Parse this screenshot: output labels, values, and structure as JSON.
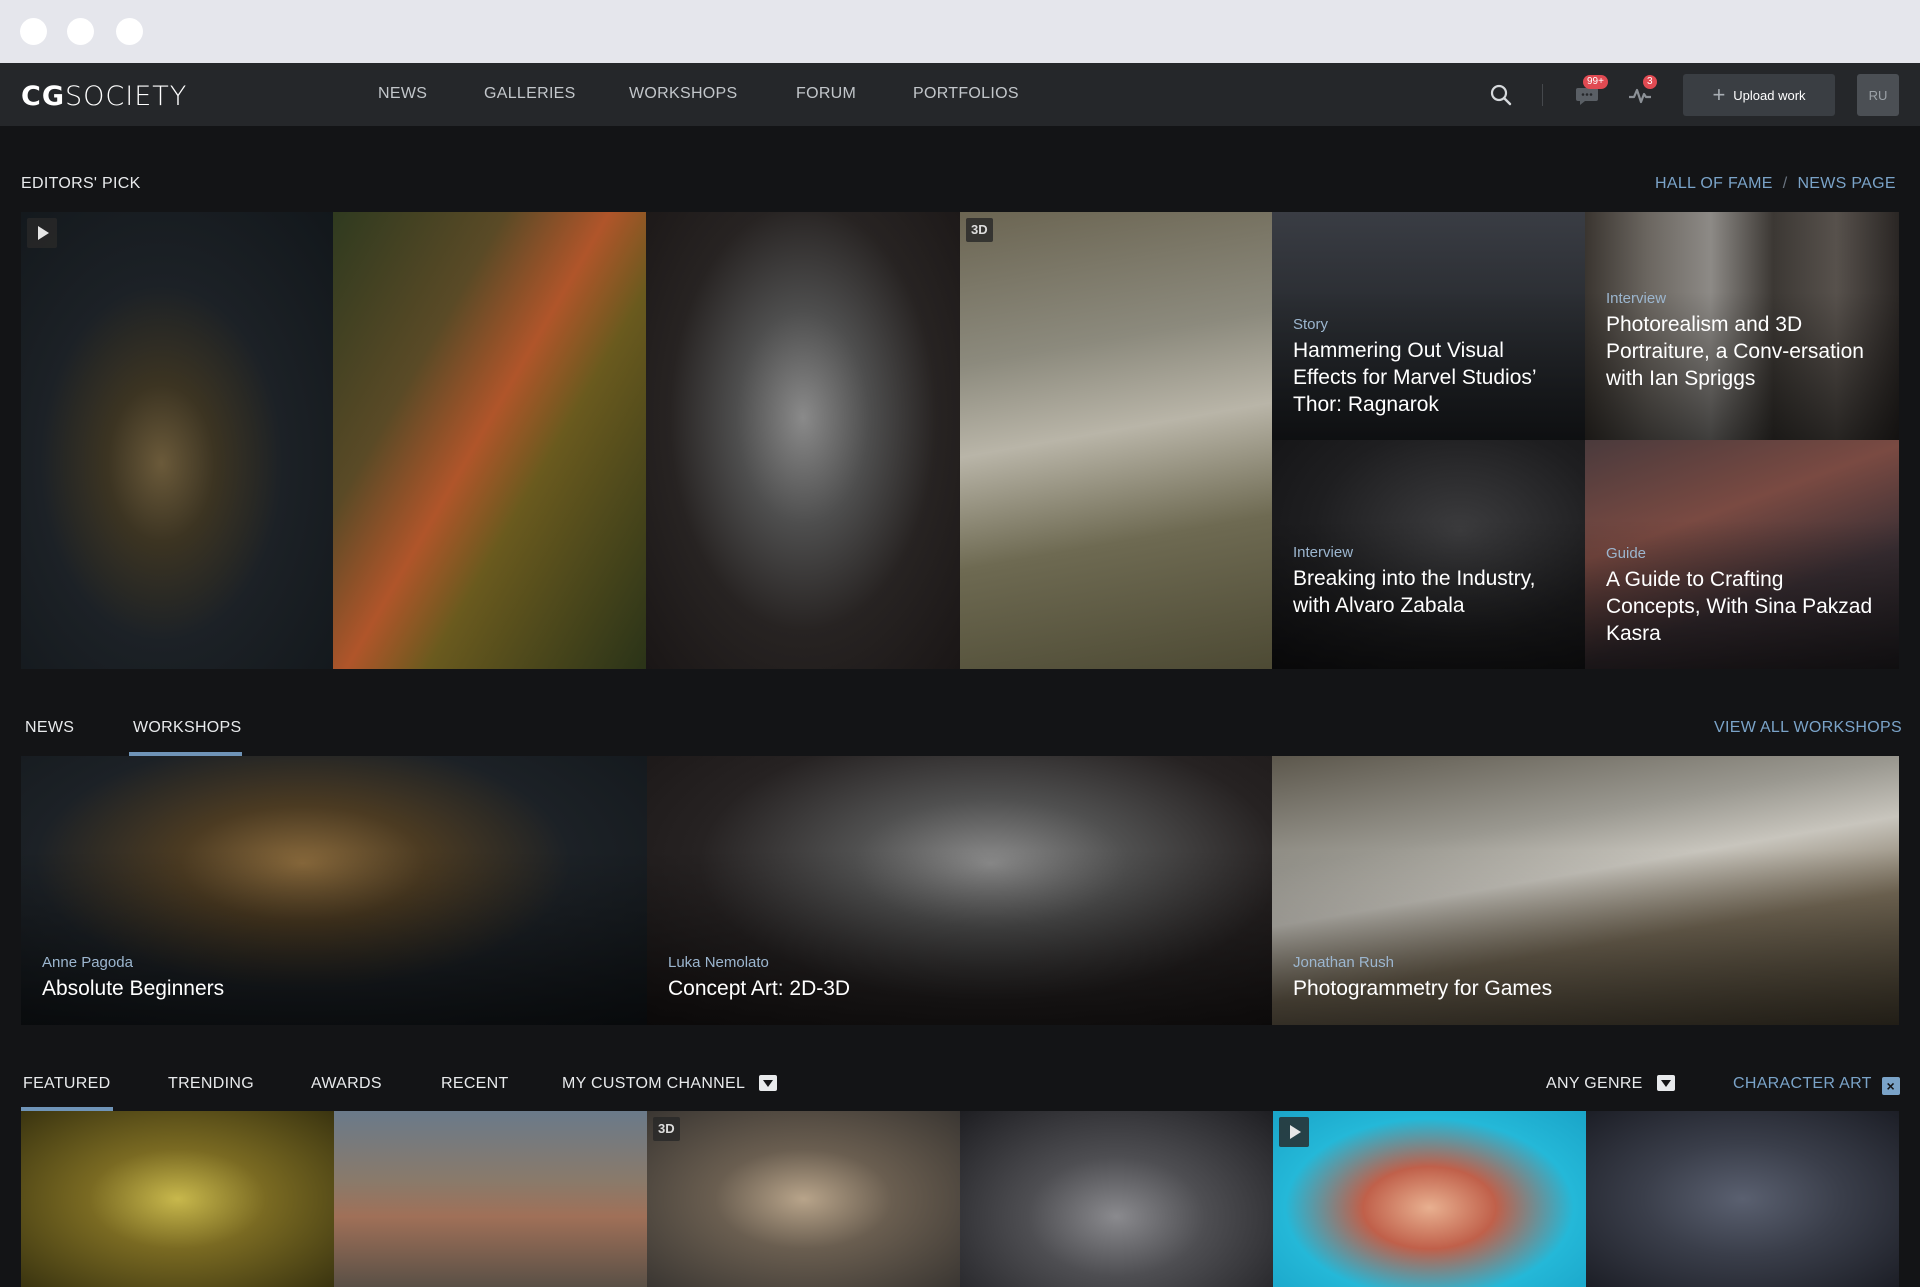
{
  "brand": {
    "logo_bold": "CG",
    "logo_light": "SOCIETY"
  },
  "nav": {
    "items": [
      "NEWS",
      "GALLERIES",
      "WORKSHOPS",
      "FORUM",
      "PORTFOLIOS"
    ],
    "messages_badge": "99+",
    "activity_badge": "3",
    "upload_label": "Upload work",
    "avatar_initials": "RU"
  },
  "editors_pick": {
    "title": "EDITORS' PICK",
    "hall_of_fame": "HALL OF FAME",
    "separator": "/",
    "news_page": "NEWS PAGE",
    "badge_3d": "3D",
    "articles": [
      {
        "kicker": "Story",
        "headline": "Hammering Out Visual Effects for Marvel Studios’ Thor: Ragnarok"
      },
      {
        "kicker": "Interview",
        "headline": "Photorealism and 3D Portraiture, a Conv-ersation with Ian Spriggs"
      },
      {
        "kicker": "Interview",
        "headline": "Breaking into the Industry, with Alvaro Zabala"
      },
      {
        "kicker": "Guide",
        "headline": "A Guide to Crafting Concepts, With Sina Pakzad Kasra"
      }
    ]
  },
  "workshops_section": {
    "tabs": [
      "NEWS",
      "WORKSHOPS"
    ],
    "view_all": "VIEW ALL WORKSHOPS",
    "cards": [
      {
        "author": "Anne Pagoda",
        "title": "Absolute Beginners"
      },
      {
        "author": "Luka Nemolato",
        "title": "Concept Art: 2D-3D"
      },
      {
        "author": "Jonathan Rush",
        "title": "Photogrammetry for Games"
      }
    ]
  },
  "gallery_section": {
    "tabs": [
      "FEATURED",
      "TRENDING",
      "AWARDS",
      "RECENT",
      "MY CUSTOM CHANNEL"
    ],
    "genre_filter": "ANY GENRE",
    "active_filter": "CHARACTER ART",
    "badge_3d": "3D"
  }
}
